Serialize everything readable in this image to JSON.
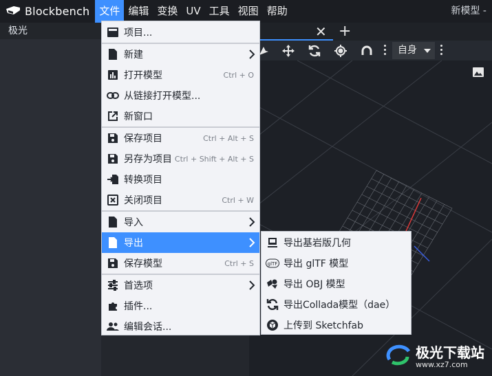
{
  "app": {
    "name": "Blockbench",
    "project_name": "新模型 -"
  },
  "menubar": [
    "文件",
    "编辑",
    "变换",
    "UV",
    "工具",
    "视图",
    "帮助"
  ],
  "left_panel": {
    "header": "极光"
  },
  "toolbar": {
    "transform_space": "自身"
  },
  "file_menu": {
    "items": [
      {
        "label": "项目...",
        "icon": "project-icon"
      },
      {
        "label": "新建",
        "icon": "file-icon",
        "submenu": true
      },
      {
        "label": "打开模型",
        "icon": "chart-icon",
        "shortcut": "Ctrl + O"
      },
      {
        "label": "从链接打开模型...",
        "icon": "link-icon"
      },
      {
        "label": "新窗口",
        "icon": "open-new-icon"
      },
      {
        "label": "保存项目",
        "icon": "save-icon",
        "shortcut": "Ctrl + Alt + S"
      },
      {
        "label": "另存为项目",
        "icon": "save-icon",
        "shortcut": "Ctrl + Shift + Alt + S"
      },
      {
        "label": "转换项目",
        "icon": "convert-icon"
      },
      {
        "label": "关闭项目",
        "icon": "close-box-icon",
        "shortcut": "Ctrl + W"
      },
      {
        "label": "导入",
        "icon": "file-icon",
        "submenu": true
      },
      {
        "label": "导出",
        "icon": "file-icon",
        "submenu": true
      },
      {
        "label": "保存模型",
        "icon": "save-icon",
        "shortcut": "Ctrl + S"
      },
      {
        "label": "首选项",
        "icon": "sliders-icon",
        "submenu": true
      },
      {
        "label": "插件...",
        "icon": "puzzle-icon"
      },
      {
        "label": "编辑会话...",
        "icon": "people-icon"
      }
    ]
  },
  "export_submenu": {
    "items": [
      {
        "label": "导出基岩版几何",
        "icon": "bedrock-icon"
      },
      {
        "label": "导出 glTF 模型",
        "icon": "gltf-icon"
      },
      {
        "label": "导出 OBJ 模型",
        "icon": "shapes-icon"
      },
      {
        "label": "导出Collada模型（dae）",
        "icon": "refresh-icon"
      },
      {
        "label": "上传到 Sketchfab",
        "icon": "sketchfab-icon"
      }
    ]
  },
  "watermark": {
    "text": "极光下载站",
    "url": "www.xz7.com"
  },
  "colors": {
    "accent": "#3e90ff",
    "menu_bg": "#f2f3f7",
    "dark_bg": "#1e2127"
  }
}
